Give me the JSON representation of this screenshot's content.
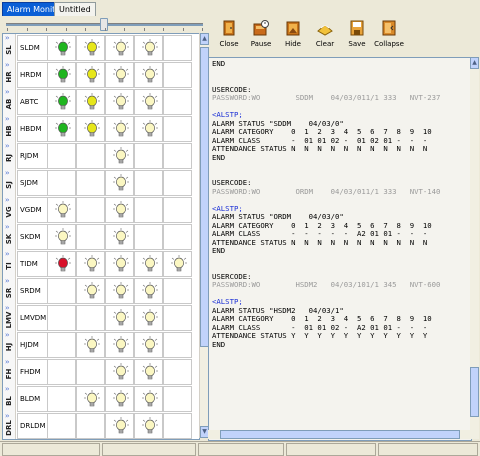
{
  "tabs": [
    {
      "label": "Alarm Monitor",
      "active": true
    },
    {
      "label": "Untitled",
      "active": false
    }
  ],
  "toolbar": [
    {
      "label": "Close",
      "icon": "close-door-icon"
    },
    {
      "label": "Pause",
      "icon": "pause-icon"
    },
    {
      "label": "Hide",
      "icon": "hide-icon"
    },
    {
      "label": "Clear",
      "icon": "clear-icon"
    },
    {
      "label": "Save",
      "icon": "save-icon"
    },
    {
      "label": "Collapse",
      "icon": "collapse-icon"
    }
  ],
  "bulb_colors": {
    "green": "#1fb51f",
    "yellow": "#e6e61a",
    "light": "#fbf7c2",
    "red": "#d8102a",
    "off": "#ffffff"
  },
  "rows": [
    {
      "code": "SL",
      "name": "SLDM",
      "bulbs": [
        "green",
        "yellow",
        "light",
        "light"
      ]
    },
    {
      "code": "HR",
      "name": "HRDM",
      "bulbs": [
        "green",
        "yellow",
        "light",
        "light"
      ]
    },
    {
      "code": "AB",
      "name": "ABTC",
      "bulbs": [
        "green",
        "yellow",
        "light",
        "light"
      ]
    },
    {
      "code": "HB",
      "name": "HBDM",
      "bulbs": [
        "green",
        "yellow",
        "light",
        "light"
      ]
    },
    {
      "code": "RJ",
      "name": "RJDM",
      "bulbs": [
        "",
        "",
        "light",
        ""
      ]
    },
    {
      "code": "SJ",
      "name": "SJDM",
      "bulbs": [
        "",
        "",
        "light",
        ""
      ]
    },
    {
      "code": "VG",
      "name": "VGDM",
      "bulbs": [
        "light",
        "",
        "light",
        ""
      ]
    },
    {
      "code": "SK",
      "name": "SKDM",
      "bulbs": [
        "light",
        "",
        "light",
        ""
      ]
    },
    {
      "code": "TI",
      "name": "TIDM",
      "bulbs": [
        "red",
        "light",
        "light",
        "light",
        "light"
      ]
    },
    {
      "code": "SR",
      "name": "SRDM",
      "bulbs": [
        "",
        "light",
        "light",
        "light"
      ]
    },
    {
      "code": "LMV",
      "name": "LMVDM",
      "bulbs": [
        "",
        "",
        "light",
        "light"
      ]
    },
    {
      "code": "HJ",
      "name": "HJDM",
      "bulbs": [
        "",
        "light",
        "light",
        "light"
      ]
    },
    {
      "code": "FH",
      "name": "FHDM",
      "bulbs": [
        "",
        "",
        "light",
        "light"
      ]
    },
    {
      "code": "BL",
      "name": "BLDM",
      "bulbs": [
        "",
        "light",
        "light",
        "light"
      ]
    },
    {
      "code": "DRL",
      "name": "DRLDM",
      "bulbs": [
        "",
        "",
        "light",
        "light"
      ]
    }
  ],
  "log": [
    {
      "t": "END",
      "c": ""
    },
    {
      "t": "",
      "c": ""
    },
    {
      "t": "",
      "c": ""
    },
    {
      "t": "USERCODE:",
      "c": ""
    },
    {
      "t": "PASSWORD:WO        SDDM    04/03/011/1 333   NVT-237",
      "c": "gray"
    },
    {
      "t": "",
      "c": ""
    },
    {
      "t": "<ALSTP;",
      "c": "blue"
    },
    {
      "t": "ALARM STATUS \"SDDM    04/03/0\"",
      "c": ""
    },
    {
      "t": "ALARM CATEGORY    0  1  2  3  4  5  6  7  8  9  10",
      "c": ""
    },
    {
      "t": "ALARM CLASS       -  01 01 02 -  01 02 01 -  -  -",
      "c": ""
    },
    {
      "t": "ATTENDANCE STATUS N  N  N  N  N  N  N  N  N  N  N",
      "c": ""
    },
    {
      "t": "END",
      "c": ""
    },
    {
      "t": "",
      "c": ""
    },
    {
      "t": "",
      "c": ""
    },
    {
      "t": "USERCODE:",
      "c": ""
    },
    {
      "t": "PASSWORD:WO        ORDM    04/03/011/1 333   NVT-140",
      "c": "gray"
    },
    {
      "t": "",
      "c": ""
    },
    {
      "t": "<ALSTP;",
      "c": "blue"
    },
    {
      "t": "ALARM STATUS \"ORDM    04/03/0\"",
      "c": ""
    },
    {
      "t": "ALARM CATEGORY    0  1  2  3  4  5  6  7  8  9  10",
      "c": ""
    },
    {
      "t": "ALARM CLASS       -  -  -  -  -  A2 01 01 -  -  -",
      "c": ""
    },
    {
      "t": "ATTENDANCE STATUS N  N  N  N  N  N  N  N  N  N  N",
      "c": ""
    },
    {
      "t": "END",
      "c": ""
    },
    {
      "t": "",
      "c": ""
    },
    {
      "t": "",
      "c": ""
    },
    {
      "t": "USERCODE:",
      "c": ""
    },
    {
      "t": "PASSWORD:WO        HSDM2   04/03/101/1 345   NVT-600",
      "c": "gray"
    },
    {
      "t": "",
      "c": ""
    },
    {
      "t": "<ALSTP;",
      "c": "blue"
    },
    {
      "t": "ALARM STATUS \"HSDM2   04/03/1\"",
      "c": ""
    },
    {
      "t": "ALARM CATEGORY    0  1  2  3  4  5  6  7  8  9  10",
      "c": ""
    },
    {
      "t": "ALARM CLASS       -  01 01 02 -  A2 01 01 -  -  -",
      "c": ""
    },
    {
      "t": "ATTENDANCE STATUS Y  Y  Y  Y  Y  Y  Y  Y  Y  Y  Y",
      "c": ""
    },
    {
      "t": "END",
      "c": ""
    }
  ]
}
